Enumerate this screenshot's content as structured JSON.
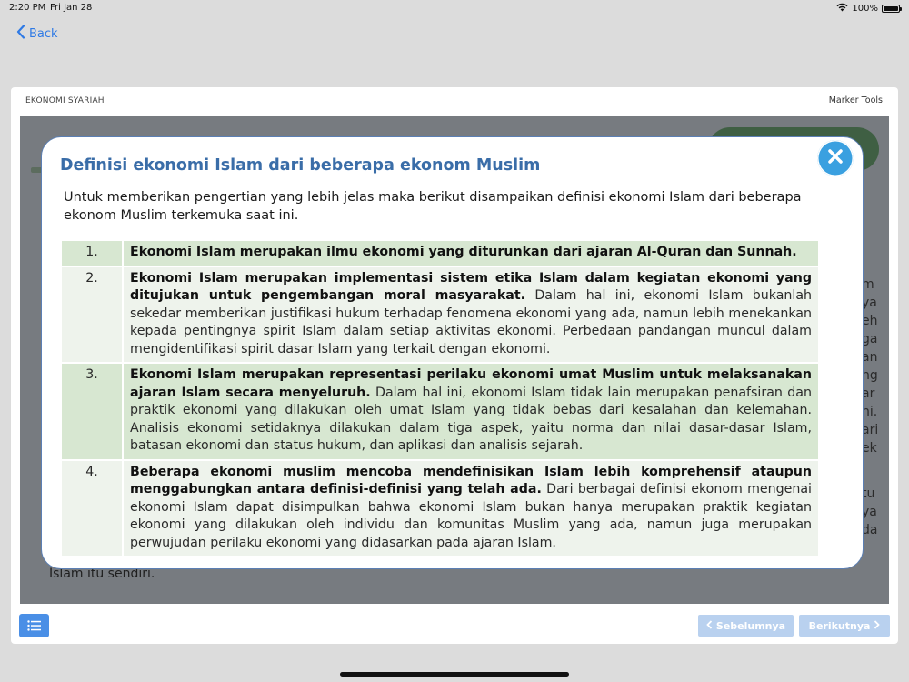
{
  "status_bar": {
    "time": "2:20 PM",
    "date": "Fri Jan 28",
    "battery": "100%",
    "battery_level": 1.0
  },
  "nav": {
    "back_label": "Back"
  },
  "card": {
    "title": "EKONOMI SYARIAH",
    "marker_tools_label": "Marker Tools"
  },
  "background": {
    "side_text": [
      "m",
      "ya",
      "eh",
      "ga",
      "an",
      "ng",
      "ar",
      "ni.",
      "ari",
      "ek"
    ],
    "side_text_lower": [
      "tu",
      "ya",
      "da"
    ],
    "bottom_text": "Islam itu sendiri."
  },
  "modal": {
    "title": "Definisi ekonomi Islam dari beberapa ekonom Muslim",
    "intro": "Untuk memberikan pengertian yang lebih jelas maka berikut disampaikan definisi ekonomi Islam dari beberapa ekonom Muslim terkemuka saat ini.",
    "definitions": [
      {
        "number": "1.",
        "bold": "Ekonomi Islam merupakan ilmu ekonomi yang diturunkan dari ajaran Al-Quran dan Sunnah.",
        "text": ""
      },
      {
        "number": "2.",
        "bold": "Ekonomi Islam merupakan implementasi sistem etika Islam dalam kegiatan ekonomi yang ditujukan untuk pengembangan moral masyarakat.",
        "text": " Dalam hal ini, ekonomi Islam bukanlah sekedar memberikan justifikasi hukum terhadap fenomena ekonomi yang ada, namun lebih menekankan kepada pentingnya spirit Islam dalam setiap aktivitas ekonomi. Perbedaan pandangan muncul dalam mengidentifikasi spirit dasar Islam yang terkait dengan ekonomi."
      },
      {
        "number": "3.",
        "bold": "Ekonomi Islam merupakan representasi perilaku ekonomi umat Muslim untuk melaksanakan ajaran Islam secara menyeluruh.",
        "text": " Dalam hal ini, ekonomi Islam tidak lain merupakan penafsiran dan praktik ekonomi yang dilakukan oleh umat Islam yang tidak bebas dari kesalahan dan kelemahan. Analisis ekonomi setidaknya dilakukan dalam tiga aspek, yaitu norma dan nilai dasar-dasar Islam, batasan ekonomi dan status hukum, dan aplikasi dan analisis sejarah."
      },
      {
        "number": "4.",
        "bold": "Beberapa ekonomi muslim mencoba mendefinisikan Islam lebih komprehensif ataupun menggabungkan antara definisi-definisi yang telah ada.",
        "text": " Dari berbagai definisi ekonom mengenai ekonomi Islam dapat disimpulkan bahwa ekonomi Islam bukan hanya merupakan praktik kegiatan ekonomi yang dilakukan oleh individu dan komunitas Muslim yang ada, namun juga merupakan perwujudan perilaku ekonomi yang didasarkan pada ajaran Islam."
      }
    ]
  },
  "footer": {
    "prev_label": "Sebelumnya",
    "next_label": "Berikutnya"
  },
  "colors": {
    "accent": "#2f7ae5",
    "modal_title": "#3a6da8",
    "row_green": "#d7e7d1",
    "row_light": "#eef3ec",
    "nav_disabled": "#b9d1ef",
    "menu_button": "#4a8fe6",
    "close_button": "#3aa0e0"
  },
  "icons": {
    "back": "chevron-left-icon",
    "close": "close-icon",
    "menu": "list-icon",
    "prev": "chevron-left-icon",
    "next": "chevron-right-icon",
    "wifi": "wifi-icon",
    "battery": "battery-icon"
  }
}
